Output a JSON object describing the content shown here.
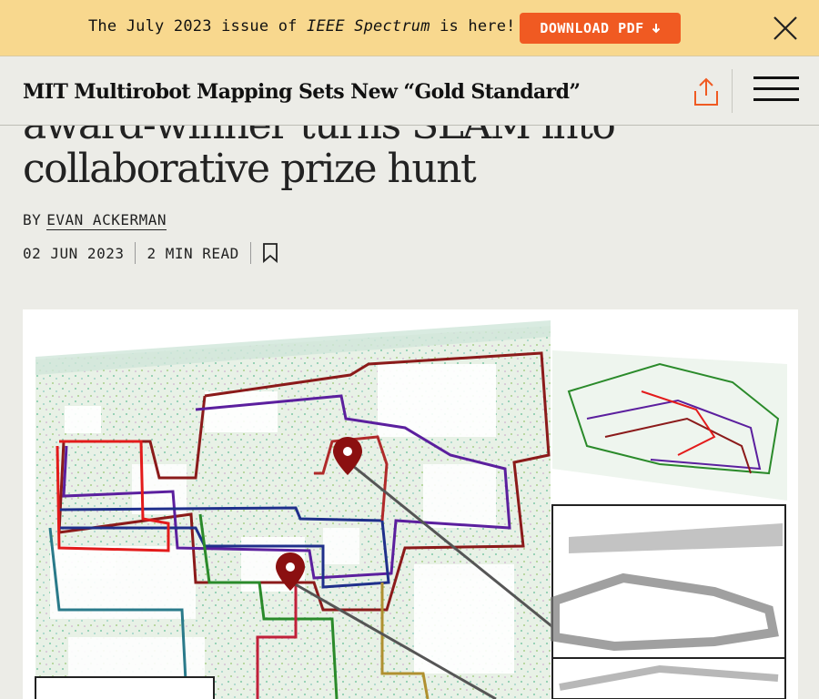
{
  "banner": {
    "text_before": "The July 2023 issue of ",
    "text_italic": "IEEE Spectrum",
    "text_after": " is here!",
    "download_label": "DOWNLOAD PDF",
    "download_icon": "down-arrow-icon",
    "close_icon": "close-icon"
  },
  "nav": {
    "title": "MIT Multirobot Mapping Sets New “Gold Standard”",
    "share_icon": "share-icon",
    "menu_icon": "hamburger-menu-icon"
  },
  "article": {
    "headline_line1": "award-winner turns SLAM into",
    "headline_line2": "collaborative prize hunt",
    "by_prefix": "BY",
    "author": "EVAN ACKERMAN",
    "date": "02 JUN 2023",
    "read_time": "2 MIN READ",
    "bookmark_icon": "bookmark-icon"
  },
  "colors": {
    "banner_bg": "#f8d88e",
    "accent": "#f05a22",
    "page_bg": "#ecece7",
    "marker": "#8b1010"
  }
}
